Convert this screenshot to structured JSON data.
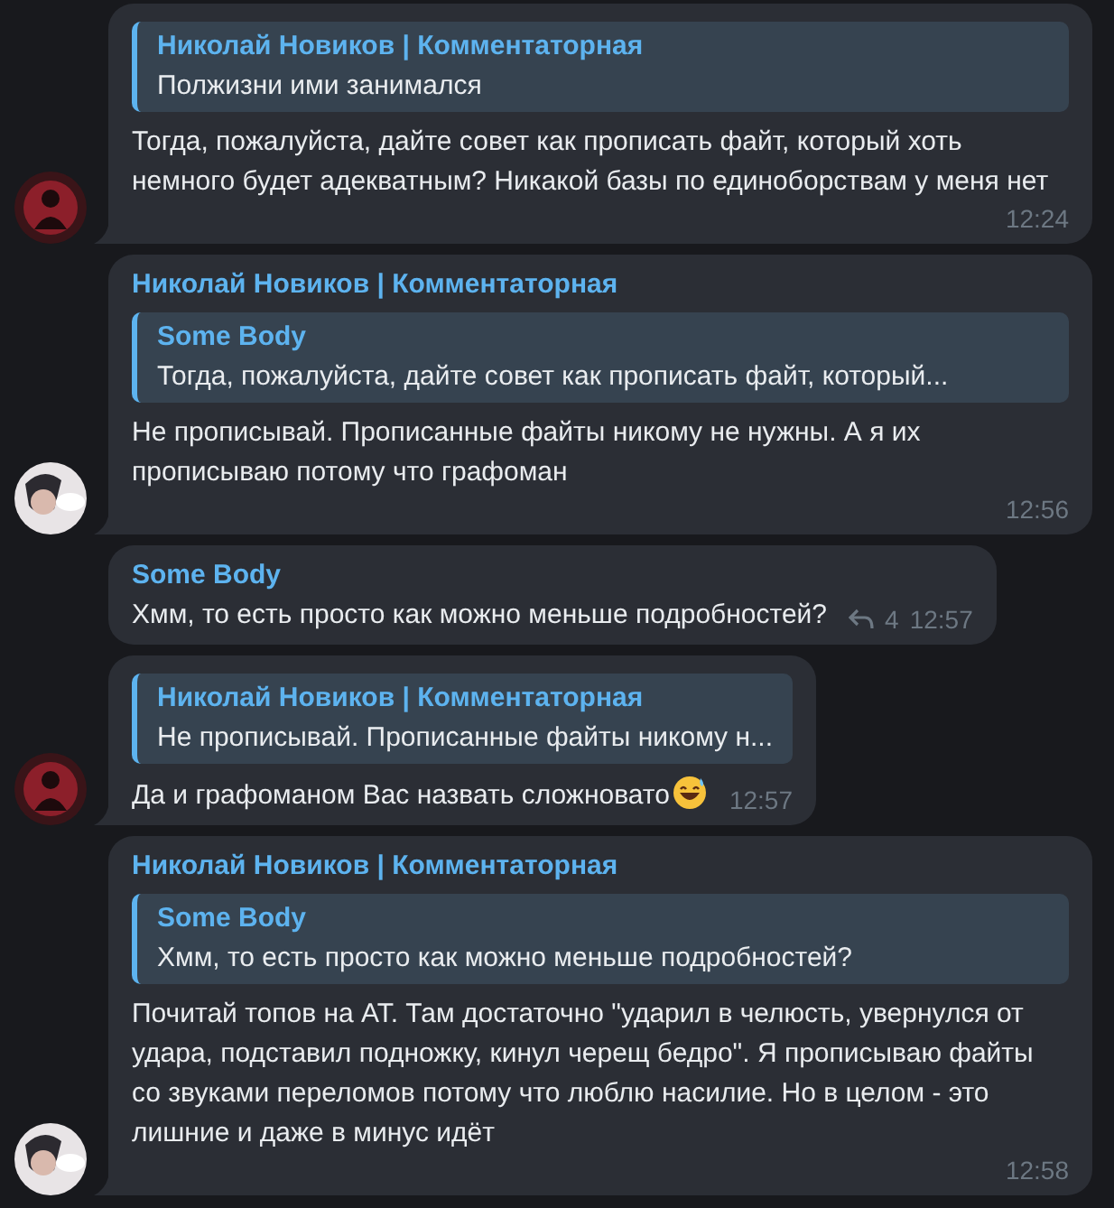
{
  "messages": [
    {
      "avatar": {
        "kind": "dark"
      },
      "reply": {
        "name": "Николай Новиков | Комментаторная",
        "text": "Полжизни ими занимался"
      },
      "text": "Тогда, пожалуйста, дайте совет как прописать файт, который хоть немного будет адекватным? Никакой базы по единоборствам у меня нет",
      "time": "12:24"
    },
    {
      "avatar": {
        "kind": "light"
      },
      "sender": "Николай Новиков | Комментаторная",
      "reply": {
        "name": "Some Body",
        "text": "Тогда, пожалуйста, дайте совет как прописать файт, который..."
      },
      "text": "Не прописывай. Прописанные файты никому не нужны. А я их прописываю потому что графоман",
      "time": "12:56"
    },
    {
      "sender": "Some Body",
      "text": "Хмм, то есть просто как можно меньше подробностей?",
      "replies": "4",
      "time": "12:57"
    },
    {
      "avatar": {
        "kind": "dark"
      },
      "reply": {
        "name": "Николай Новиков | Комментаторная",
        "text": "Не прописывай. Прописанные файты никому н..."
      },
      "text": "Да и графоманом Вас назвать сложновато",
      "emoji": true,
      "time": "12:57"
    },
    {
      "avatar": {
        "kind": "light"
      },
      "sender": "Николай Новиков | Комментаторная",
      "reply": {
        "name": "Some Body",
        "text": "Хмм, то есть просто как можно меньше подробностей?"
      },
      "text": "Почитай топов на АТ. Там достаточно \"ударил в челюсть, увернулся от удара, подставил подножку, кинул черещ бедро\". Я прописываю файты со звуками переломов потому что люблю насилие. Но в целом - это лишние и даже в минус идёт",
      "time": "12:58"
    }
  ]
}
